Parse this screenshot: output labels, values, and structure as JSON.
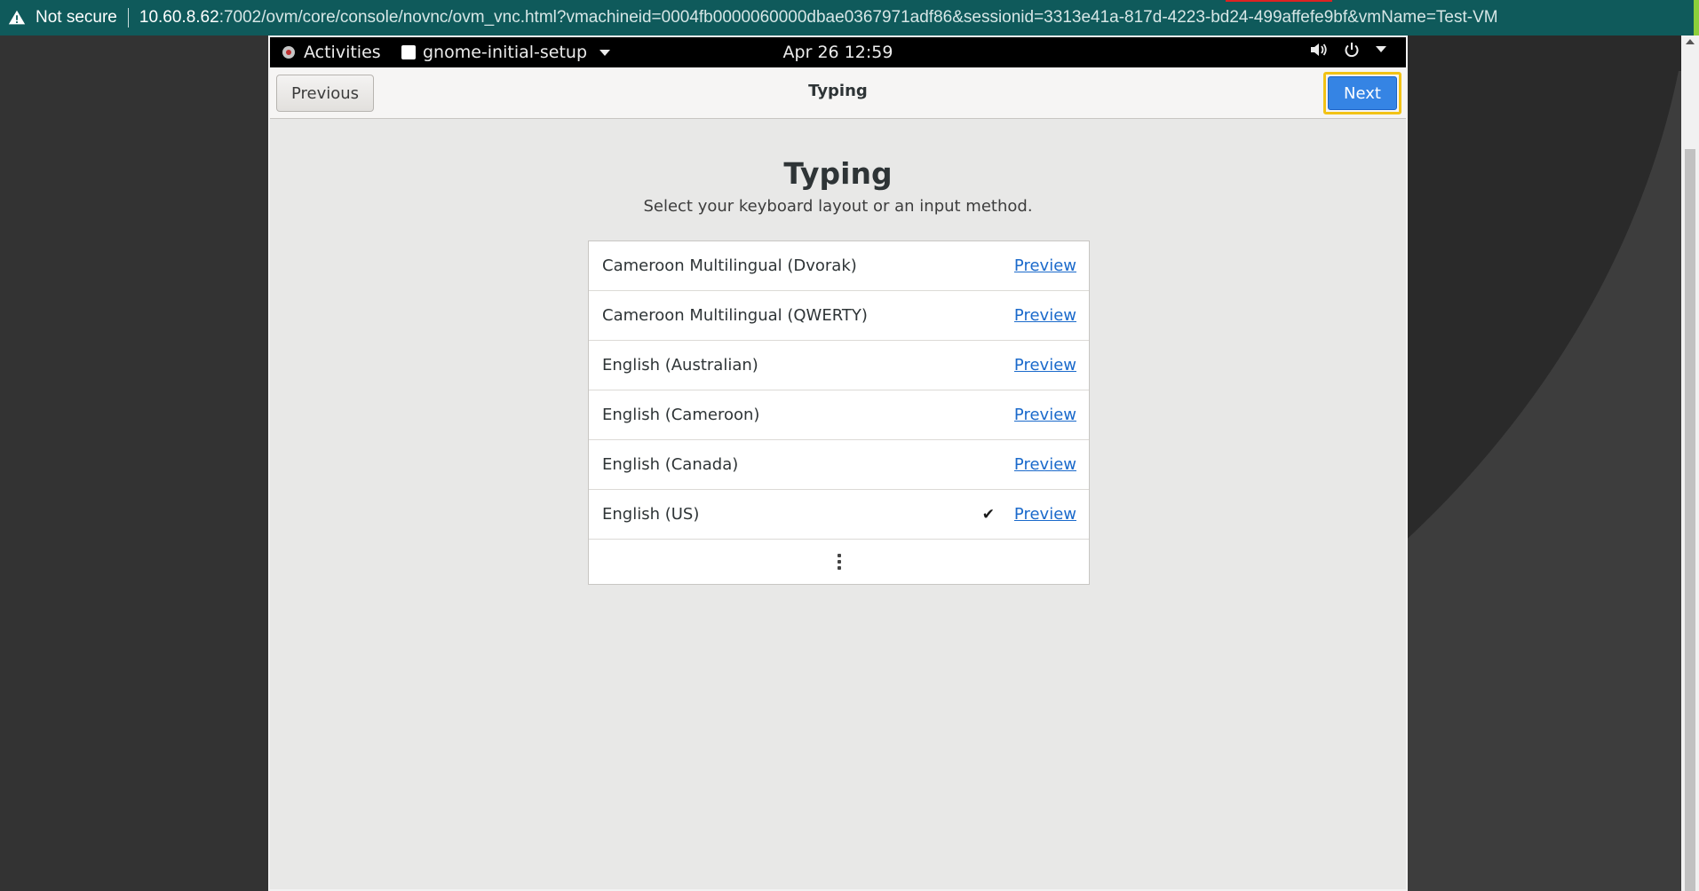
{
  "browser": {
    "not_secure": "Not secure",
    "url_host": "10.60.8.62",
    "url_rest": ":7002/ovm/core/console/novnc/ovm_vnc.html?vmachineid=0004fb0000060000dbae0367971adf86&sessionid=3313e41a-817d-4223-bd24-499affefe9bf&vmName=Test-VM"
  },
  "gnome_topbar": {
    "activities": "Activities",
    "app_menu": "gnome-initial-setup",
    "clock": "Apr 26  12:59",
    "icons": [
      "volume-icon",
      "power-icon",
      "chevron-down-icon"
    ]
  },
  "headerbar": {
    "previous": "Previous",
    "title": "Typing",
    "next": "Next"
  },
  "content": {
    "title": "Typing",
    "subtitle": "Select your keyboard layout or an input method."
  },
  "layouts": {
    "items": [
      {
        "label": "Cameroon Multilingual (Dvorak)",
        "preview": "Preview",
        "selected": false
      },
      {
        "label": "Cameroon Multilingual (QWERTY)",
        "preview": "Preview",
        "selected": false
      },
      {
        "label": "English (Australian)",
        "preview": "Preview",
        "selected": false
      },
      {
        "label": "English (Cameroon)",
        "preview": "Preview",
        "selected": false
      },
      {
        "label": "English (Canada)",
        "preview": "Preview",
        "selected": false
      },
      {
        "label": "English (US)",
        "preview": "Preview",
        "selected": true
      }
    ],
    "check_mark": "✔"
  },
  "colors": {
    "accent": "#3584e4",
    "focus_ring": "#f2c215",
    "link": "#1b6acb",
    "browser_bar": "#0f5a5b"
  }
}
